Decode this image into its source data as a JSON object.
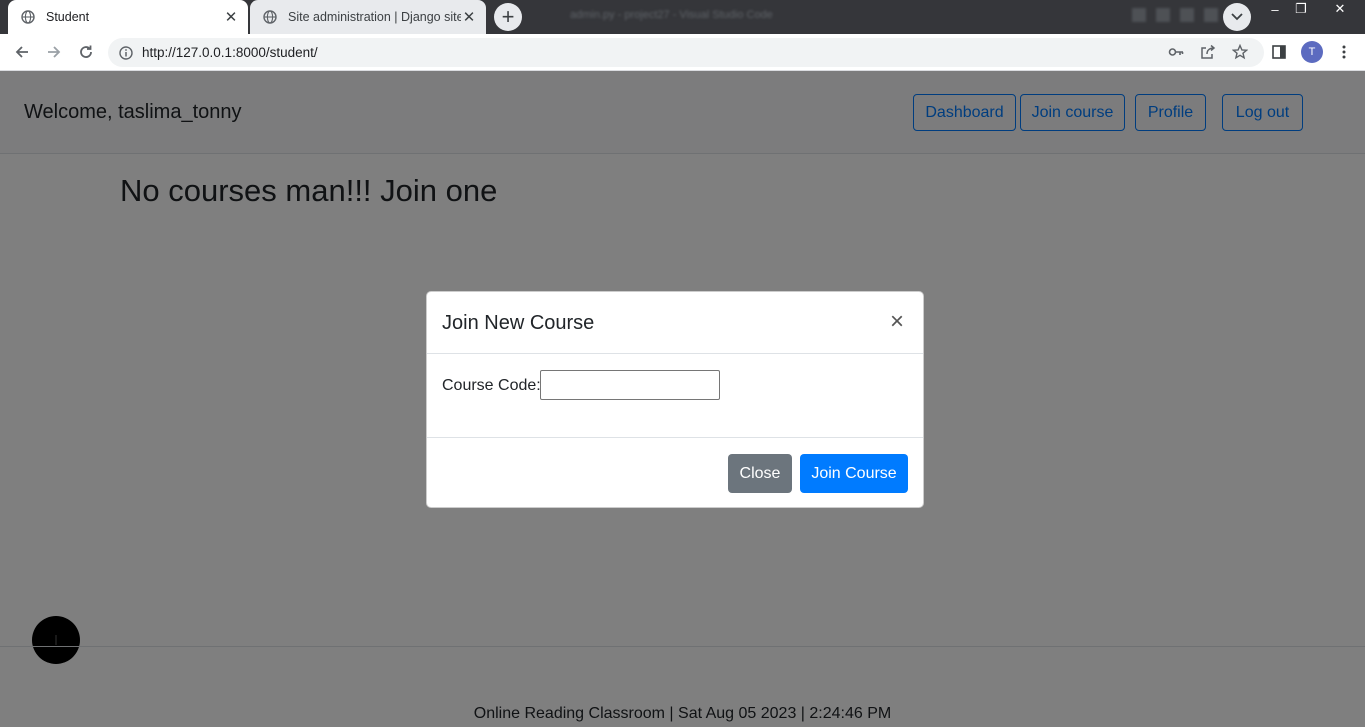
{
  "browser": {
    "tabs": [
      {
        "title": "Student"
      },
      {
        "title": "Site administration | Django site admin"
      }
    ],
    "window_title": "admin.py - project27 - Visual Studio Code",
    "url": "http://127.0.0.1:8000/student/",
    "profile_initial": "T",
    "icons": {
      "favicon": "globe-icon",
      "back": "back-arrow-icon",
      "forward": "forward-arrow-icon",
      "reload": "reload-icon",
      "site_info": "info-icon",
      "passwords": "key-icon",
      "share": "share-icon",
      "bookmark": "star-icon",
      "side_panel": "side-panel-icon",
      "menu": "kebab-menu-icon"
    },
    "window_controls": {
      "minimize": "–",
      "restore": "❐",
      "close": "✕"
    }
  },
  "navbar": {
    "welcome": "Welcome, taslima_tonny",
    "buttons": {
      "dashboard": "Dashboard",
      "join_course": "Join course",
      "profile": "Profile",
      "logout": "Log out"
    }
  },
  "main": {
    "heading": "No courses man!!! Join one"
  },
  "footer": {
    "text": "Online Reading Classroom | Sat Aug 05 2023 | 2:24:46 PM"
  },
  "modal": {
    "title": "Join New Course",
    "close_symbol": "×",
    "course_code_label": "Course Code:",
    "course_code_value": "",
    "close_button": "Close",
    "join_button": "Join Course"
  },
  "colors": {
    "primary": "#007bff",
    "secondary": "#6c757d",
    "backdrop": "rgba(0,0,0,0.5)"
  }
}
